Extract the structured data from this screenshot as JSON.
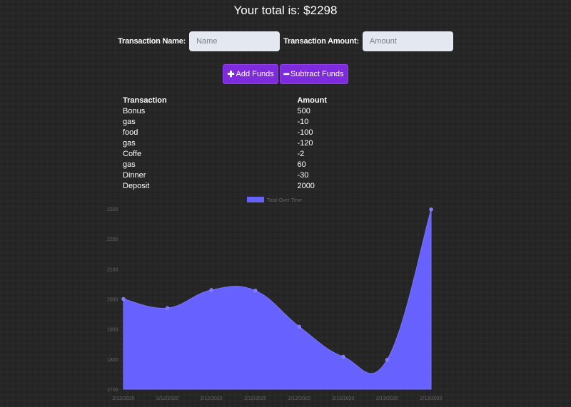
{
  "header": {
    "total_text": "Your total is: $2298"
  },
  "form": {
    "name_label": "Transaction Name:",
    "name_placeholder": "Name",
    "name_value": "",
    "amount_label": "Transaction Amount:",
    "amount_placeholder": "Amount",
    "amount_value": ""
  },
  "buttons": {
    "add_icon": "plus-icon",
    "add_label": "Add Funds",
    "subtract_icon": "minus-icon",
    "subtract_label": "Subtract Funds",
    "color": "#7d2bdc"
  },
  "table": {
    "headers": [
      "Transaction",
      "Amount"
    ],
    "rows": [
      [
        "Bonus",
        "500"
      ],
      [
        "gas",
        "-10"
      ],
      [
        "food",
        "-100"
      ],
      [
        "gas",
        "-120"
      ],
      [
        "Coffe",
        "-2"
      ],
      [
        "gas",
        "60"
      ],
      [
        "Dinner",
        "-30"
      ],
      [
        "Deposit",
        "2000"
      ]
    ]
  },
  "chart_data": {
    "type": "area",
    "x": [
      "2/12/2020",
      "2/12/2020",
      "2/12/2020",
      "2/12/2020",
      "2/12/2020",
      "2/13/2020",
      "2/13/2020",
      "2/13/2020"
    ],
    "series": [
      {
        "name": "Total Over Time",
        "values": [
          2000,
          1970,
          2030,
          2028,
          1908,
          1808,
          1798,
          2298
        ],
        "color": "#6661ff"
      }
    ],
    "yticks": [
      1700,
      1800,
      1900,
      2000,
      2100,
      2200,
      2300
    ],
    "ylim": [
      1700,
      2300
    ],
    "grid": false,
    "legend": "top-center"
  }
}
